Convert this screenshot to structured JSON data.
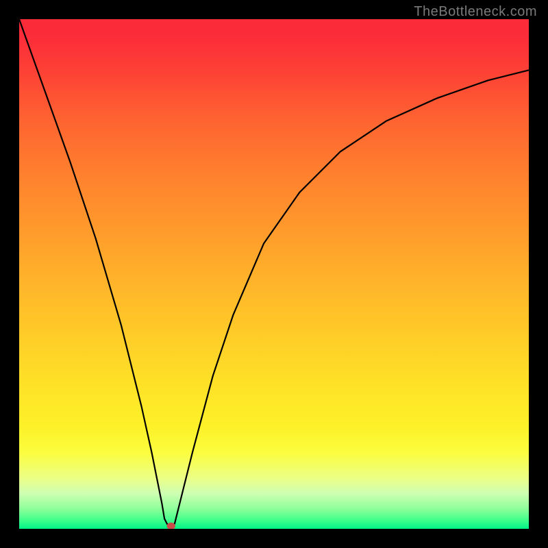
{
  "attribution": "TheBottleneck.com",
  "chart_data": {
    "type": "line",
    "title": "",
    "xlabel": "",
    "ylabel": "",
    "xlim": [
      0,
      100
    ],
    "ylim": [
      0,
      100
    ],
    "x": [
      0,
      5,
      10,
      15,
      20,
      24,
      26,
      27,
      28,
      28.5,
      29,
      29.5,
      30,
      30.5,
      31,
      32,
      34,
      38,
      42,
      48,
      55,
      63,
      72,
      82,
      92,
      100
    ],
    "values": [
      100,
      86,
      72,
      57,
      40,
      24,
      15,
      10,
      5,
      2,
      1,
      0.5,
      0.5,
      1,
      3,
      7,
      15,
      30,
      42,
      56,
      66,
      74,
      80,
      84.5,
      88,
      90
    ],
    "minimum": {
      "x": 29.8,
      "y": 0
    },
    "background_gradient": {
      "stops": [
        {
          "pos": 0,
          "color": "#fc2b3a"
        },
        {
          "pos": 50,
          "color": "#ffb02a"
        },
        {
          "pos": 85,
          "color": "#fbfd3e"
        },
        {
          "pos": 100,
          "color": "#00f186"
        }
      ]
    }
  }
}
